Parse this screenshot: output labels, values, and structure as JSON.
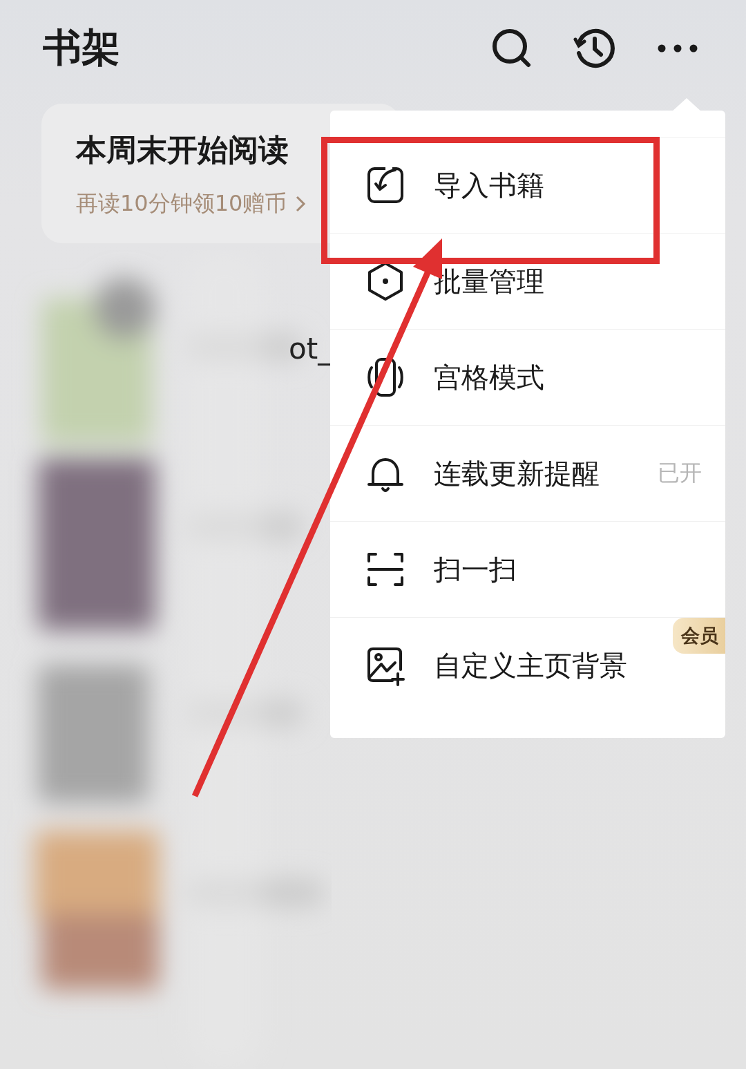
{
  "header": {
    "title": "书架"
  },
  "banner": {
    "title": "本周末开始阅读",
    "subtitle": "再读10分钟领10赠币"
  },
  "shelf": {
    "fragments": [
      "ot_"
    ]
  },
  "menu": {
    "items": [
      {
        "label": "导入书籍",
        "highlighted": true
      },
      {
        "label": "批量管理",
        "highlighted": false
      },
      {
        "label": "宫格模式",
        "highlighted": false
      },
      {
        "label": "连载更新提醒",
        "status": "已开",
        "highlighted": false
      },
      {
        "label": "扫一扫",
        "highlighted": false
      },
      {
        "label": "自定义主页背景",
        "badge": "会员",
        "highlighted": false
      }
    ]
  }
}
